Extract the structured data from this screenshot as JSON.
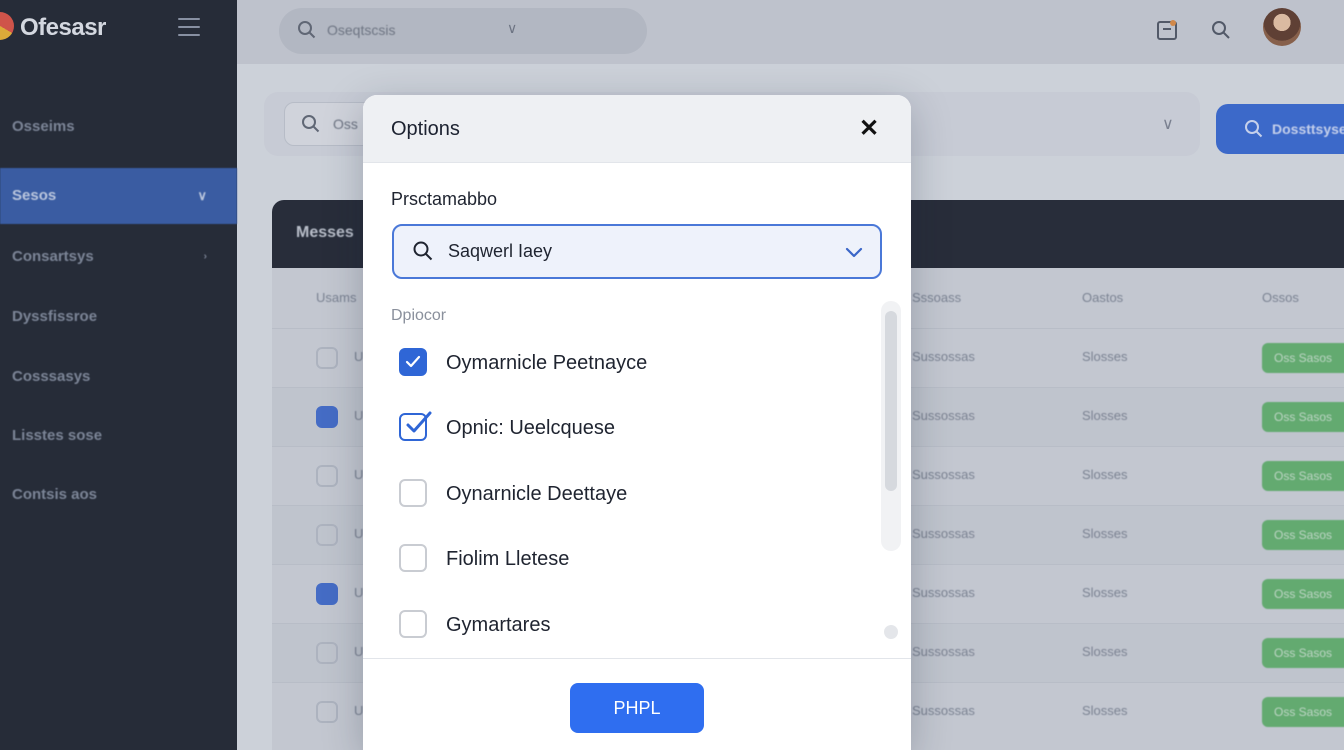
{
  "app": {
    "brand_name": "Ofesasr"
  },
  "sidebar": {
    "items": [
      {
        "label": "Osseims"
      },
      {
        "label": "Sesos"
      },
      {
        "label": "Consartsys"
      },
      {
        "label": "Dyssfissroe"
      },
      {
        "label": "Cosssasys"
      },
      {
        "label": "Lisstes sose"
      },
      {
        "label": "Contsis aos"
      }
    ]
  },
  "topbar": {
    "search_text": "Oseqtscsis"
  },
  "filters": {
    "search_text": "Oss"
  },
  "primary_action": {
    "label": "Dossttsyse"
  },
  "table": {
    "title": "Messes",
    "columns": [
      "Usams",
      "Sssoass",
      "Oastos",
      "Ossos"
    ],
    "rows": [
      {
        "checked": false,
        "name": "Uls",
        "col3": "Sussossas",
        "col4": "Slosses",
        "badge": "Oss Sasos"
      },
      {
        "checked": true,
        "name": "Uls",
        "col3": "Sussossas",
        "col4": "Slosses",
        "badge": "Oss Sasos"
      },
      {
        "checked": false,
        "name": "Uls",
        "col3": "Sussossas",
        "col4": "Slosses",
        "badge": "Oss Sasos"
      },
      {
        "checked": false,
        "name": "Uls",
        "col3": "Sussossas",
        "col4": "Slosses",
        "badge": "Oss Sasos"
      },
      {
        "checked": true,
        "name": "Uls",
        "col3": "Sussossas",
        "col4": "Slosses",
        "badge": "Oss Sasos"
      },
      {
        "checked": false,
        "name": "Uls",
        "col3": "Sussossas",
        "col4": "Slosses",
        "badge": "Oss Sasos"
      },
      {
        "checked": false,
        "name": "Uls",
        "col3": "Sussossas",
        "col4": "Slosses",
        "badge": "Oss Sasos"
      }
    ]
  },
  "modal": {
    "title": "Options",
    "close_icon": "close-icon",
    "section_label": "Prsctamabbo",
    "select_value": "Saqwerl Iaey",
    "group_label": "Dpiocor",
    "options": [
      {
        "label": "Oymarnicle Peetnayce",
        "state": "checked"
      },
      {
        "label": "Opnic: Ueelcquese",
        "state": "checked-outline"
      },
      {
        "label": "Oynarnicle Deettaye",
        "state": "unchecked"
      },
      {
        "label": "Fiolim Lletese",
        "state": "unchecked"
      },
      {
        "label": "Gymartares",
        "state": "unchecked"
      }
    ],
    "apply_label": "PHPL"
  },
  "colors": {
    "accent": "#2f6ef0",
    "sidebar_bg": "#141a25",
    "sidebar_active": "#2c55a6",
    "badge_green": "#5fb46a"
  }
}
